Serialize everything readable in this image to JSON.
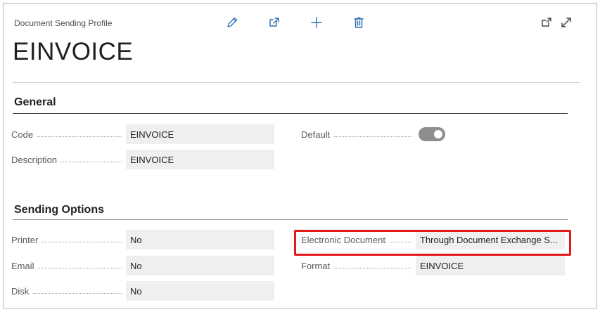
{
  "header": {
    "window_label": "Document Sending Profile",
    "title": "EINVOICE",
    "icons": [
      "edit-icon",
      "share-icon",
      "new-icon",
      "delete-icon",
      "open-new-window-icon",
      "expand-icon"
    ]
  },
  "general": {
    "title": "General",
    "code_label": "Code",
    "code_value": "EINVOICE",
    "description_label": "Description",
    "description_value": "EINVOICE",
    "default_label": "Default",
    "default_on": true
  },
  "sending": {
    "title": "Sending Options",
    "printer_label": "Printer",
    "printer_value": "No",
    "email_label": "Email",
    "email_value": "No",
    "disk_label": "Disk",
    "disk_value": "No",
    "electronic_label": "Electronic Document",
    "electronic_value": "Through Document Exchange S...",
    "format_label": "Format",
    "format_value": "EINVOICE"
  },
  "colors": {
    "accent": "#2f6fb3",
    "highlight": "#e21a1a"
  }
}
